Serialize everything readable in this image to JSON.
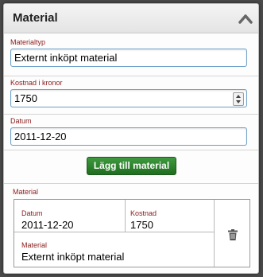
{
  "header": {
    "title": "Material"
  },
  "fields": {
    "materialtyp": {
      "label": "Materialtyp",
      "value": "Externt inköpt material"
    },
    "kostnad": {
      "label": "Kostnad i kronor",
      "value": "1750"
    },
    "datum": {
      "label": "Datum",
      "value": "2011-12-20"
    }
  },
  "add_button": {
    "label": "Lägg till material"
  },
  "material_list": {
    "label": "Material",
    "item": {
      "datum_label": "Datum",
      "datum_value": "2011-12-20",
      "kostnad_label": "Kostnad",
      "kostnad_value": "1750",
      "material_label": "Material",
      "material_value": "Externt inköpt material"
    }
  },
  "colors": {
    "label_red": "#8b1a1a",
    "button_green": "#2e7d2e",
    "input_border": "#6fa0c8"
  },
  "icons": [
    "chevron-up-icon",
    "spinner-up-icon",
    "spinner-down-icon",
    "trash-icon"
  ]
}
